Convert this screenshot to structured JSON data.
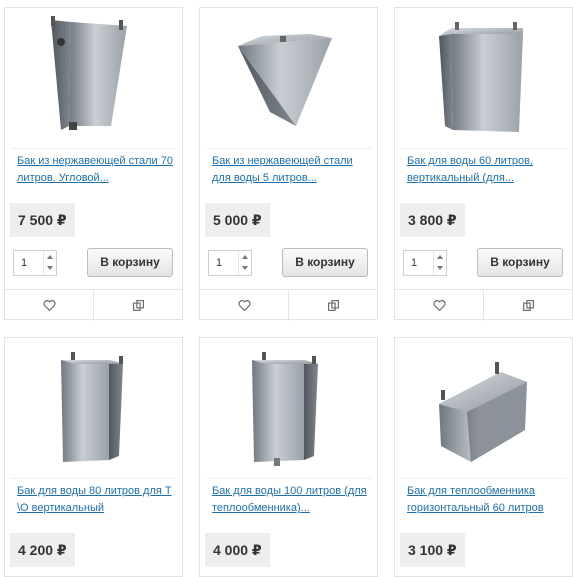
{
  "products": [
    {
      "title": "Бак из нержавеющей стали 70 литров. Угловой...",
      "price": "7 500 ₽",
      "qty": "1",
      "cart_label": "В корзину"
    },
    {
      "title": "Бак из нержавеющей стали для воды 5 литров...",
      "price": "5 000 ₽",
      "qty": "1",
      "cart_label": "В корзину"
    },
    {
      "title": "Бак для воды 60 литров, вертикальный (для...",
      "price": "3 800 ₽",
      "qty": "1",
      "cart_label": "В корзину"
    },
    {
      "title": "Бак для воды 80 литров для Т \\О вертикальный",
      "price": "4 200 ₽"
    },
    {
      "title": "Бак для воды 100 литров (для теплообменника)...",
      "price": "4 000 ₽"
    },
    {
      "title": "Бак для теплообменника горизонтальный 60 литров",
      "price": "3 100 ₽"
    }
  ],
  "icons": {
    "wishlist": "heart-icon",
    "compare": "compare-icon"
  },
  "colors": {
    "link": "#1e6fae",
    "price_bg": "#eeeeee",
    "border": "#e3e3e3"
  }
}
